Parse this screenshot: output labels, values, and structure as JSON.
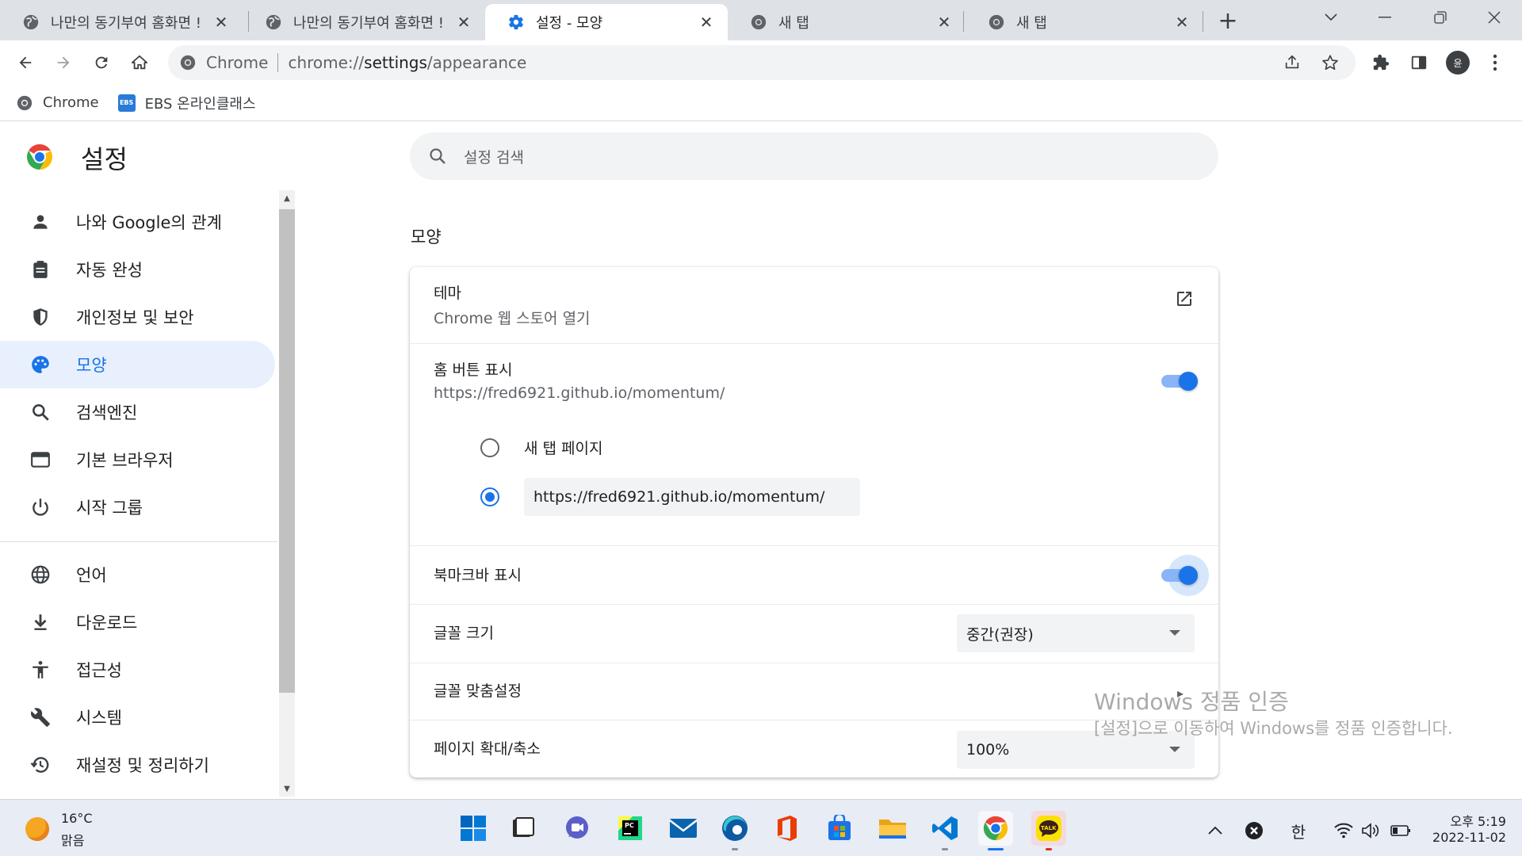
{
  "tabs": [
    {
      "title": "나만의 동기부여 홈화면 !",
      "icon": "globe-icon"
    },
    {
      "title": "나만의 동기부여 홈화면 !",
      "icon": "globe-icon"
    },
    {
      "title": "설정 - 모양",
      "icon": "gear-icon",
      "active": true
    },
    {
      "title": "새 탭",
      "icon": "chrome-icon"
    },
    {
      "title": "새 탭",
      "icon": "chrome-icon"
    }
  ],
  "omnibox": {
    "scheme_label": "Chrome",
    "url_host": "chrome://",
    "url_path_bold": "settings",
    "url_path_rest": "/appearance"
  },
  "profile": {
    "initial": "윤"
  },
  "bookmarks": [
    {
      "label": "Chrome",
      "icon": "chrome-icon"
    },
    {
      "label": "EBS 온라인클래스",
      "icon": "ebs-icon",
      "icon_text": "EBS"
    }
  ],
  "settings": {
    "title": "설정",
    "search_placeholder": "설정 검색",
    "nav": [
      {
        "label": "나와 Google의 관계",
        "icon": "person-icon"
      },
      {
        "label": "자동 완성",
        "icon": "clipboard-icon"
      },
      {
        "label": "개인정보 및 보안",
        "icon": "shield-icon"
      },
      {
        "label": "모양",
        "icon": "palette-icon",
        "active": true
      },
      {
        "label": "검색엔진",
        "icon": "search-icon"
      },
      {
        "label": "기본 브라우저",
        "icon": "browser-icon"
      },
      {
        "label": "시작 그룹",
        "icon": "power-icon"
      },
      {
        "label": "언어",
        "icon": "globe-icon"
      },
      {
        "label": "다운로드",
        "icon": "download-icon"
      },
      {
        "label": "접근성",
        "icon": "accessibility-icon"
      },
      {
        "label": "시스템",
        "icon": "wrench-icon"
      },
      {
        "label": "재설정 및 정리하기",
        "icon": "restore-icon"
      }
    ],
    "section_title": "모양",
    "theme": {
      "label": "테마",
      "sub": "Chrome 웹 스토어 열기"
    },
    "home_button": {
      "label": "홈 버튼 표시",
      "sub": "https://fred6921.github.io/momentum/",
      "enabled": true,
      "options": [
        {
          "label": "새 탭 페이지",
          "checked": false
        }
      ],
      "custom_url_value": "https://fred6921.github.io/momentum/"
    },
    "bookmark_bar": {
      "label": "북마크바 표시",
      "enabled": true
    },
    "font_size": {
      "label": "글꼴 크기",
      "value": "중간(권장)"
    },
    "customize_fonts": {
      "label": "글꼴 맞춤설정"
    },
    "page_zoom": {
      "label": "페이지 확대/축소",
      "value": "100%"
    }
  },
  "watermark": {
    "title": "Windows 정품 인증",
    "sub": "[설정]으로 이동하여 Windows를 정품 인증합니다."
  },
  "taskbar": {
    "weather": {
      "temp": "16°C",
      "desc": "맑음"
    },
    "apps": [
      "windows-start-icon",
      "terminal-icon",
      "chat-icon",
      "pycharm-icon",
      "mail-icon",
      "edge-icon",
      "office-icon",
      "store-icon",
      "file-explorer-icon",
      "vscode-icon",
      "chrome-icon",
      "kakaotalk-icon"
    ],
    "pycharm_text": "PC",
    "kakao_text": "TALK",
    "ime": "한",
    "clock_time": "오후 5:19",
    "clock_date": "2022-11-02"
  },
  "colors": {
    "accent": "#1a73e8",
    "accent_light": "#8ab4f8",
    "nav_active_bg": "#e8f0fe"
  }
}
